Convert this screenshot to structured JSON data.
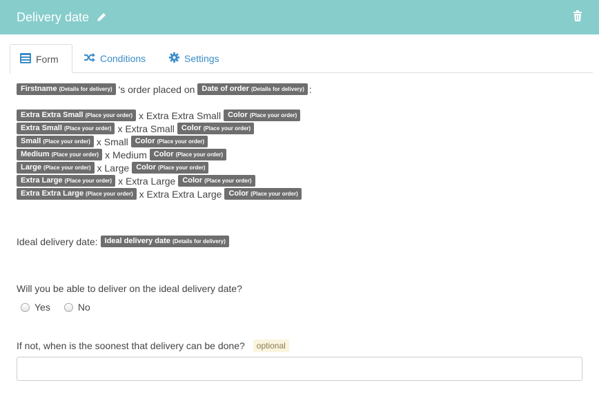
{
  "header": {
    "title": "Delivery date",
    "background": "#86cdcc",
    "edit_icon": "pencil-icon",
    "delete_icon": "trash-icon"
  },
  "tabs": [
    {
      "label": "Form",
      "icon": "form-list-icon",
      "active": true
    },
    {
      "label": "Conditions",
      "icon": "shuffle-icon",
      "active": false
    },
    {
      "label": "Settings",
      "icon": "gear-icon",
      "active": false
    }
  ],
  "order_line": {
    "tag1": "Firstname",
    "tag1_sub": "(Details for delivery)",
    "text": "'s order placed on",
    "tag2": "Date of order",
    "tag2_sub": "(Details for delivery)",
    "suffix": ":"
  },
  "sizes": [
    {
      "tag": "Extra Extra Small",
      "sub": "(Place your order)",
      "text": "x Extra Extra Small",
      "color_tag": "Color",
      "color_sub": "(Place your order)"
    },
    {
      "tag": "Extra Small",
      "sub": "(Place your order)",
      "text": "x Extra Small",
      "color_tag": "Color",
      "color_sub": "(Place your order)"
    },
    {
      "tag": "Small",
      "sub": "(Place your order)",
      "text": "x Small",
      "color_tag": "Color",
      "color_sub": "(Place your order)"
    },
    {
      "tag": "Medium",
      "sub": "(Place your order)",
      "text": "x Medium",
      "color_tag": "Color",
      "color_sub": "(Place your order)"
    },
    {
      "tag": "Large",
      "sub": "(Place your order)",
      "text": "x Large",
      "color_tag": "Color",
      "color_sub": "(Place your order)"
    },
    {
      "tag": "Extra Large",
      "sub": "(Place your order)",
      "text": "x Extra Large",
      "color_tag": "Color",
      "color_sub": "(Place your order)"
    },
    {
      "tag": "Extra Extra Large",
      "sub": "(Place your order)",
      "text": "x Extra Extra Large",
      "color_tag": "Color",
      "color_sub": "(Place your order)"
    }
  ],
  "ideal": {
    "label": "Ideal delivery date:",
    "tag": "Ideal delivery date",
    "tag_sub": "(Details for delivery)"
  },
  "question": {
    "label": "Will you be able to deliver on the ideal delivery date?",
    "options": [
      "Yes",
      "No"
    ]
  },
  "soonest": {
    "label": "If not, when is the soonest that delivery can be done?",
    "badge": "optional",
    "value": ""
  }
}
